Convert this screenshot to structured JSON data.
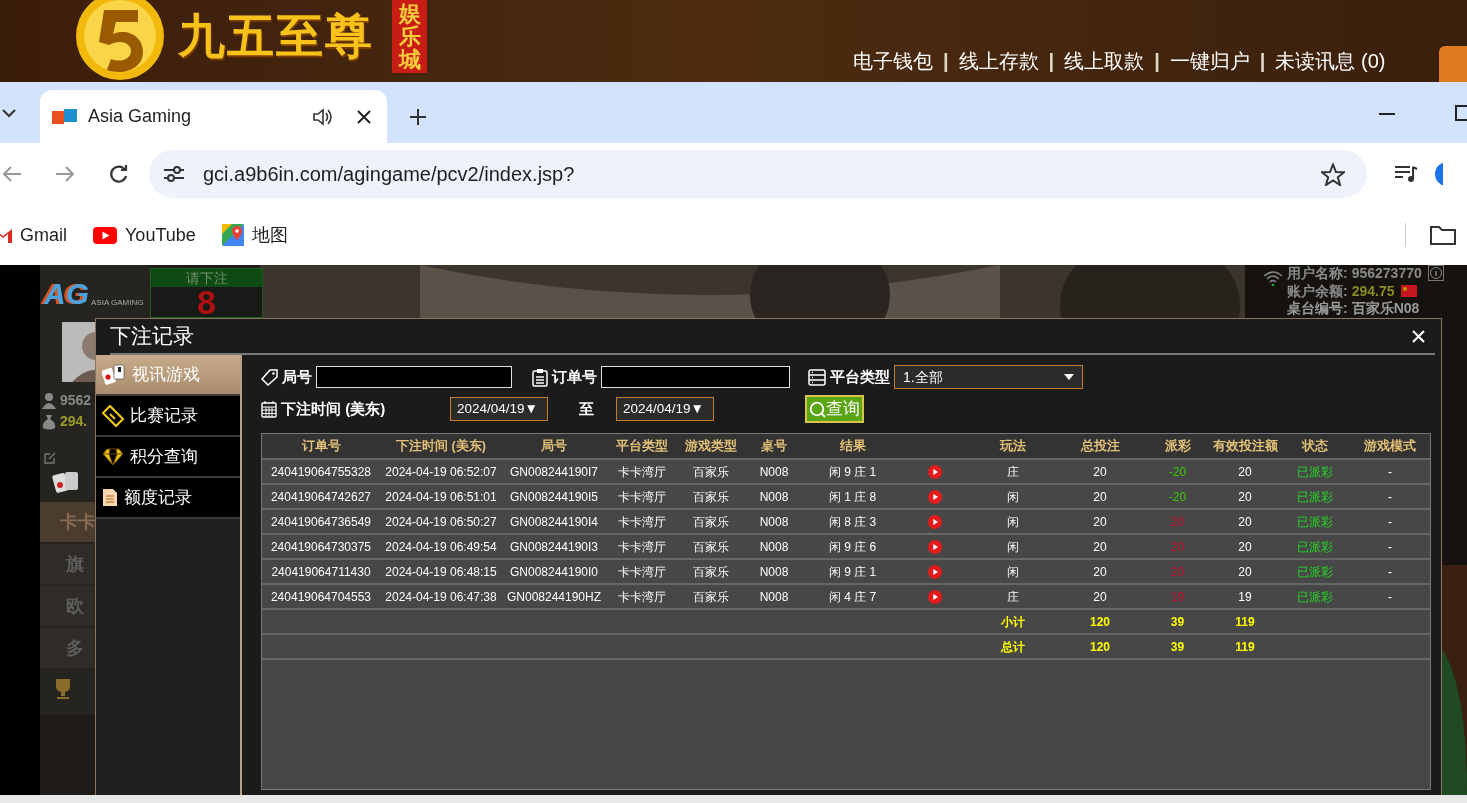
{
  "site_header": {
    "logo_text": "九五至尊",
    "logo_badge": "娱乐城",
    "nav": [
      {
        "kind": "link",
        "text": "电子钱包"
      },
      {
        "kind": "separator",
        "text": "|"
      },
      {
        "kind": "link",
        "text": "线上存款"
      },
      {
        "kind": "separator",
        "text": "|"
      },
      {
        "kind": "link",
        "text": "线上取款"
      },
      {
        "kind": "separator",
        "text": "|"
      },
      {
        "kind": "link",
        "text": "一键归户"
      },
      {
        "kind": "separator",
        "text": "|"
      },
      {
        "kind": "link",
        "text": "未读讯息 (0)"
      }
    ]
  },
  "browser": {
    "tabs": [
      {
        "title": "Asia Gaming",
        "selected": true
      }
    ],
    "url": "gci.a9b6in.com/agingame/pcv2/index.jsp?",
    "bookmarks": [
      {
        "kind": "gmail",
        "label": "Gmail"
      },
      {
        "kind": "youtube",
        "label": "YouTube"
      },
      {
        "kind": "maps",
        "label": "地图"
      }
    ]
  },
  "game": {
    "logo": "AG",
    "logo_caption": "ASIA GAMING",
    "countdown_label": "请下注",
    "countdown": "8",
    "player_stats": [
      "9562",
      "294."
    ],
    "lobby_items": [
      {
        "label": "卡卡",
        "selected": true
      },
      {
        "label": "旗",
        "selected": false
      },
      {
        "label": "欧",
        "selected": false
      },
      {
        "label": "多",
        "selected": false
      }
    ],
    "user_info": [
      {
        "label": "用户名称:",
        "value": "956273770",
        "kind": "name"
      },
      {
        "label": "账户余额:",
        "value": "294.75",
        "kind": "balance"
      },
      {
        "label": "桌台编号:",
        "value": "百家乐N08",
        "kind": "table"
      }
    ]
  },
  "bet_record_dialog": {
    "title": "下注记录",
    "menu": [
      {
        "kind": "cards",
        "label": "视讯游戏",
        "selected": true
      },
      {
        "kind": "ticket",
        "label": "比赛记录",
        "selected": false
      },
      {
        "kind": "diamond",
        "label": "积分查询",
        "selected": false
      },
      {
        "kind": "document",
        "label": "额度记录",
        "selected": false
      }
    ],
    "filters": {
      "round_label": "局号",
      "order_label": "订单号",
      "platform_label": "平台类型",
      "platform_value": "1.全部",
      "time_label": "下注时间 (美东)",
      "date_from": "2024/04/19▼",
      "to_label": "至",
      "date_to": "2024/04/19▼",
      "search_button": "查询"
    },
    "table": {
      "columns": [
        "订单号",
        "下注时间 (美东)",
        "局号",
        "平台类型",
        "游戏类型",
        "桌号",
        "结果",
        "玩法",
        "总投注",
        "派彩",
        "有效投注额",
        "状态",
        "游戏模式"
      ],
      "rows": [
        {
          "order": "240419064755328",
          "time": "2024-04-19 06:52:07",
          "round": "GN008244190I7",
          "platform": "卡卡湾厅",
          "game": "百家乐",
          "table": "N008",
          "result": "闲 9 庄 1",
          "video": true,
          "play": "庄",
          "bet": "20",
          "payout": "-20",
          "payout_win": false,
          "valid_bet": "20",
          "status": "已派彩",
          "mode": "-"
        },
        {
          "order": "240419064742627",
          "time": "2024-04-19 06:51:01",
          "round": "GN008244190I5",
          "platform": "卡卡湾厅",
          "game": "百家乐",
          "table": "N008",
          "result": "闲 1 庄 8",
          "video": true,
          "play": "闲",
          "bet": "20",
          "payout": "-20",
          "payout_win": false,
          "valid_bet": "20",
          "status": "已派彩",
          "mode": "-"
        },
        {
          "order": "240419064736549",
          "time": "2024-04-19 06:50:27",
          "round": "GN008244190I4",
          "platform": "卡卡湾厅",
          "game": "百家乐",
          "table": "N008",
          "result": "闲 8 庄 3",
          "video": true,
          "play": "闲",
          "bet": "20",
          "payout": "20",
          "payout_win": true,
          "valid_bet": "20",
          "status": "已派彩",
          "mode": "-"
        },
        {
          "order": "240419064730375",
          "time": "2024-04-19 06:49:54",
          "round": "GN008244190I3",
          "platform": "卡卡湾厅",
          "game": "百家乐",
          "table": "N008",
          "result": "闲 9 庄 6",
          "video": true,
          "play": "闲",
          "bet": "20",
          "payout": "20",
          "payout_win": true,
          "valid_bet": "20",
          "status": "已派彩",
          "mode": "-"
        },
        {
          "order": "240419064711430",
          "time": "2024-04-19 06:48:15",
          "round": "GN008244190I0",
          "platform": "卡卡湾厅",
          "game": "百家乐",
          "table": "N008",
          "result": "闲 9 庄 1",
          "video": true,
          "play": "闲",
          "bet": "20",
          "payout": "20",
          "payout_win": true,
          "valid_bet": "20",
          "status": "已派彩",
          "mode": "-"
        },
        {
          "order": "240419064704553",
          "time": "2024-04-19 06:47:38",
          "round": "GN008244190HZ",
          "platform": "卡卡湾厅",
          "game": "百家乐",
          "table": "N008",
          "result": "闲 4 庄 7",
          "video": true,
          "play": "庄",
          "bet": "20",
          "payout": "19",
          "payout_win": true,
          "valid_bet": "19",
          "status": "已派彩",
          "mode": "-"
        }
      ],
      "totals": [
        {
          "label": "小计",
          "bet": "120",
          "payout": "39",
          "valid_bet": "119"
        },
        {
          "label": "总计",
          "bet": "120",
          "payout": "39",
          "valid_bet": "119"
        }
      ]
    }
  }
}
